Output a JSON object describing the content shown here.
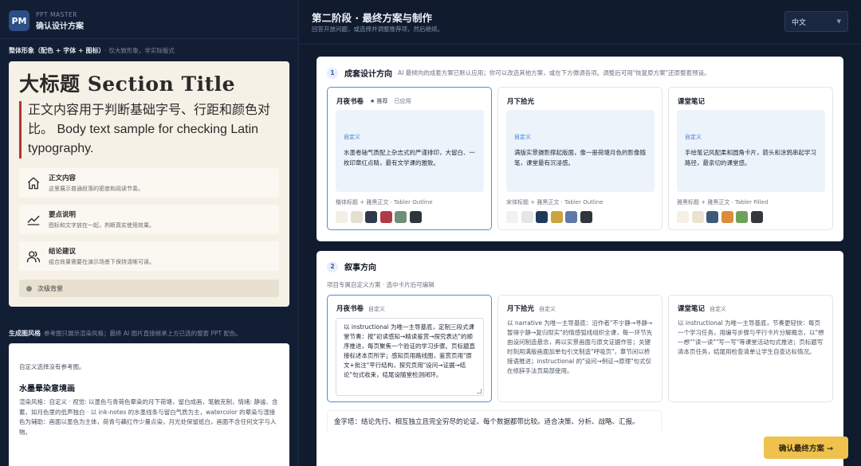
{
  "app": {
    "logo": "PM",
    "name": "PPT MASTER",
    "title": "确认设计方案"
  },
  "sidebar": {
    "preview_label": "整体形象（配色 + 字体 + 图标）",
    "preview_note": "· 仅大致形象，非实际版式",
    "preview": {
      "heading": "大标题 Section Title",
      "body": "正文内容用于判断基础字号、行距和颜色对比。 Body text sample for checking Latin typography.",
      "items": [
        {
          "icon": "home-icon",
          "title": "正文内容",
          "desc": "这里展示普通段落的密度和阅读节奏。"
        },
        {
          "icon": "chart-line-icon",
          "title": "要点说明",
          "desc": "图标和文字放在一起，判断真实使用效果。"
        },
        {
          "icon": "users-icon",
          "title": "结论建议",
          "desc": "组合效果需要在演示场景下保持清晰可读。"
        }
      ],
      "secondary": "次级背景"
    },
    "style_label": "生成图风格",
    "style_note": "参考图只展示渲染风格；最终 AI 图片直接继承上方已选的整套 PPT 配色。",
    "style": {
      "empty": "自定义选择没有参考图。",
      "title": "水墨晕染意境画",
      "desc": "渲染风格：自定义 · 视觉: 以墨色与青荷色晕染的月下荷塘，留白成画，笔触克制，情绪: 静谧、含蓄，如月色里的低声独白 · 以 ink-notes 的水墨线条与留白气质为主，watercolor 的晕染与湿接色为辅助：画面以墨色为主体，荷青与藕红作少量点染，月光处保留纸白，画面不含任何文字与人物。"
    }
  },
  "header": {
    "title": "第二阶段 · 最终方案与制作",
    "subtitle": "回答开放问题，或选择并调整推荐项，然后继续。",
    "language": "中文"
  },
  "design": {
    "num": "1",
    "title": "成套设计方向",
    "note": "AI 最倾向的成套方案已默认应用；你可以改选其他方案，或在下方微调各项。调整后可用\"恢复原方案\"还原整套预设。",
    "cards": [
      {
        "name": "月夜书卷",
        "badge": "★ 推荐",
        "applied": "已应用",
        "tag": "自定义",
        "text": "水墨卷轴气质配上杂志式的严谨排印，大留白、一枚印章红点睛，最有文学课的雅致。",
        "fonts": "楷体标题 + 雅黑正文 · Tabler Outline",
        "swatches": [
          "#f3efe6",
          "#e6dfd0",
          "#2f3a4b",
          "#b23a48",
          "#6f8f7a",
          "#2f3538"
        ]
      },
      {
        "name": "月下拾光",
        "tag": "自定义",
        "text": "满版实景摄影撑起版面，像一册荷塘月色的影像随笔，课堂最有沉浸感。",
        "fonts": "宋体标题 + 雅黑正文 · Tabler Outline",
        "swatches": [
          "#f2f2f0",
          "#e4e6e8",
          "#1f3b5c",
          "#c9a43f",
          "#5f7aa8",
          "#2f3538"
        ]
      },
      {
        "name": "课堂笔记",
        "tag": "自定义",
        "text": "手绘笔记风配柔和圆角卡片，箭头和涂鸦串起学习路径，最亲切的课堂感。",
        "fonts": "雅黑标题 + 雅黑正文 · Tabler Filled",
        "swatches": [
          "#f5efe4",
          "#ebe3cf",
          "#3e5a78",
          "#dc8c3a",
          "#6fa05a",
          "#34393d"
        ]
      }
    ]
  },
  "narrative": {
    "num": "2",
    "title": "叙事方向",
    "sub": "项目专属自定义方案 · 选中卡片后可编辑",
    "cards": [
      {
        "name": "月夜书卷",
        "custom": "自定义",
        "text": "以 instructional 为唯一主导基底，定制三段式课堂节奏：按\"初读感知→精读鉴赏→探究表达\"的顺序推进，每页聚焦一个验证的学习步骤。页标题直接标述本页所学；感知页用路线图，鉴赏页用\"原文+批注\"平行结构，探究页用\"设问→证据→结论\"句式收束，结尾设随堂检测闭环。"
      },
      {
        "name": "月下拾光",
        "custom": "自定义",
        "text": "以 narrative 为唯一主导基底：沿作者\"不宁静→寻静→暂得宁静→复归现实\"的情感弧线组织全课，每一环节先由设问制造悬念，再以实景画面与原文证据作答；关键时刻用满版画面加单句引文制造\"呼吸页\"，章节间以桥接语推进；instructional 的\"设问→例证→原理\"句式仅在修辞手法页局部使用。"
      },
      {
        "name": "课堂笔记",
        "custom": "自定义",
        "text": "以 instructional 为唯一主导基底，节奏更轻快：每页一个学习任务，用编号步骤与平行卡片分解概念，以\"想一想\"\"读一读\"\"写一写\"等课堂活动句式推进；页标题写清本页任务，结尾用检查清单让学生自查达标情况。"
      }
    ],
    "footer": "金字塔：结论先行、相互独立且完全穷尽的论证、每个数据都带比较。适合决策、分析、战略、汇报。"
  },
  "actions": {
    "confirm": "确认最终方案 →"
  }
}
